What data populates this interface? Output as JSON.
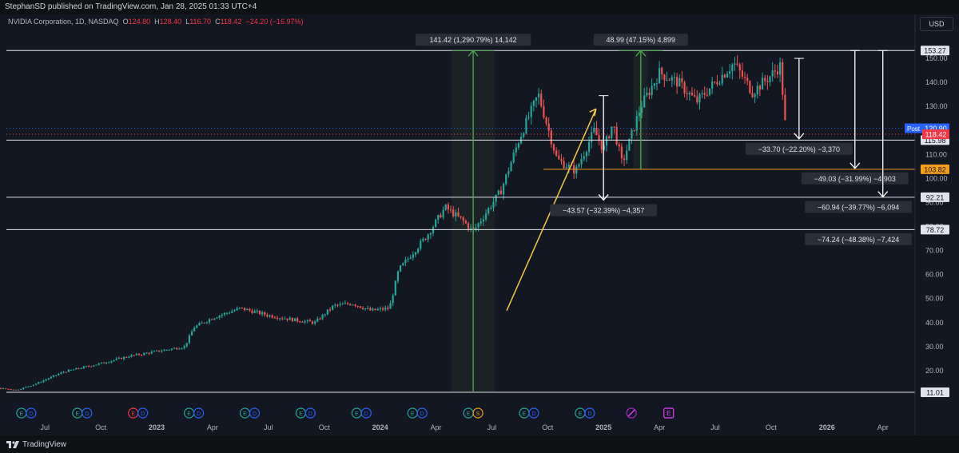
{
  "header": {
    "published": "StephanSD published on TradingView.com, Jan 28, 2025 01:33 UTC+4"
  },
  "legend": {
    "symbol": "NVIDIA Corporation, 1D, NASDAQ",
    "o_label": "O",
    "o": "124.80",
    "h_label": "H",
    "h": "128.40",
    "l_label": "L",
    "l": "116.70",
    "c_label": "C",
    "c": "118.42",
    "change": "−24.20 (−16.97%)"
  },
  "currency": "USD",
  "footer": {
    "brand": "TradingView"
  },
  "colors": {
    "background": "#131722",
    "up": "#26a69a",
    "down": "#ef5350",
    "trend": "#f5c842",
    "measure_up": "#4caf50",
    "level_orange": "#f59c1a",
    "post": "#2962ff",
    "last": "#f23645"
  },
  "chart_data": {
    "type": "candlestick",
    "symbol": "NVDA",
    "interval": "1D",
    "y_range": [
      9,
      161
    ],
    "y_ticks": [
      "20.00",
      "30.00",
      "40.00",
      "50.00",
      "60.00",
      "70.00",
      "80.00",
      "90.00",
      "100.00",
      "110.00",
      "120.00",
      "130.00",
      "140.00",
      "150.00"
    ],
    "x_ticks": [
      "Jul",
      "Oct",
      "2023",
      "Apr",
      "Jul",
      "Oct",
      "2024",
      "Apr",
      "Jul",
      "Oct",
      "2025",
      "Apr",
      "Jul",
      "Oct",
      "2026",
      "Apr"
    ],
    "price_path": [
      [
        -13.5,
        19
      ],
      [
        -12,
        17
      ],
      [
        -10.5,
        16.5
      ],
      [
        -9,
        13
      ],
      [
        -7.5,
        12
      ],
      [
        -6.5,
        14.5
      ],
      [
        -5,
        19.5
      ],
      [
        -3,
        23
      ],
      [
        -1.5,
        26
      ],
      [
        0,
        28
      ],
      [
        1.5,
        30
      ],
      [
        2,
        38
      ],
      [
        3,
        42
      ],
      [
        4.5,
        46
      ],
      [
        6,
        43
      ],
      [
        7.5,
        41
      ],
      [
        8.5,
        40
      ],
      [
        9.5,
        47
      ],
      [
        10.5,
        48
      ],
      [
        11.5,
        45
      ],
      [
        12.5,
        46
      ],
      [
        13,
        62
      ],
      [
        14.5,
        76
      ],
      [
        15.5,
        88
      ],
      [
        16.5,
        82
      ],
      [
        17,
        78
      ],
      [
        18.5,
        95
      ],
      [
        19.5,
        117
      ],
      [
        20.5,
        135
      ],
      [
        21.5,
        108
      ],
      [
        22.5,
        103
      ],
      [
        23.5,
        120
      ],
      [
        24,
        112
      ],
      [
        24.5,
        123
      ],
      [
        25,
        106
      ],
      [
        25.5,
        118
      ],
      [
        26,
        130
      ],
      [
        27,
        144
      ],
      [
        28,
        140
      ],
      [
        29,
        132
      ],
      [
        30,
        140
      ],
      [
        31,
        148
      ],
      [
        32,
        136
      ],
      [
        33,
        143
      ],
      [
        33.5,
        147
      ],
      [
        33.8,
        118.4
      ]
    ],
    "levels": [
      {
        "price": "153.27",
        "value": 153.27,
        "style": "white"
      },
      {
        "price": "115.98",
        "value": 115.98,
        "style": "white"
      },
      {
        "price": "103.82",
        "value": 103.82,
        "style": "orange"
      },
      {
        "price": "92.21",
        "value": 92.21,
        "style": "white"
      },
      {
        "price": "78.72",
        "value": 78.72,
        "style": "white"
      },
      {
        "price": "11.01",
        "value": 11.01,
        "style": "white"
      }
    ],
    "price_labels": {
      "post": {
        "tag": "Post",
        "price": "120.90",
        "value": 120.9
      },
      "last": {
        "price": "118.42",
        "value": 118.42
      }
    },
    "measurements": [
      {
        "label": "141.42 (1,290.79%) 14,142",
        "direction": "up",
        "from": 11.01,
        "to": 153.27,
        "month": 17
      },
      {
        "label": "48.99 (47.15%) 4,899",
        "direction": "up",
        "from": 103.82,
        "to": 153.27,
        "month": 26
      },
      {
        "label": "−43.57 (−32.39%) −4,357",
        "direction": "down",
        "from": 134.5,
        "to": 91,
        "month": 24
      },
      {
        "label": "−33.70 (−22.20%) −3,370",
        "direction": "down",
        "from": 150,
        "to": 116.5,
        "month": 34.5
      },
      {
        "label": "−49.03 (−31.99%) −4,903",
        "direction": "down",
        "from": 153.27,
        "to": 104.2,
        "month": 37.5
      },
      {
        "label": "−60.94 (−39.77%) −6,094",
        "direction": "down",
        "from": 153.27,
        "to": 92.3,
        "month": 39
      },
      {
        "label": "−74.24 (−48.38%) −7,424",
        "direction": "down",
        "from": 153.27,
        "to": 78.9,
        "month": 42
      }
    ],
    "trend_line": {
      "from_month": 18.8,
      "from_value": 45,
      "to_month": 23.6,
      "to_value": 129
    },
    "events_row": [
      "ED",
      "ED",
      "ED",
      "ED",
      "ED",
      "ED",
      "ED",
      "ED",
      "ES",
      "ED",
      "ED",
      "split",
      "E"
    ],
    "grid": false,
    "legend_position": "top-left"
  }
}
